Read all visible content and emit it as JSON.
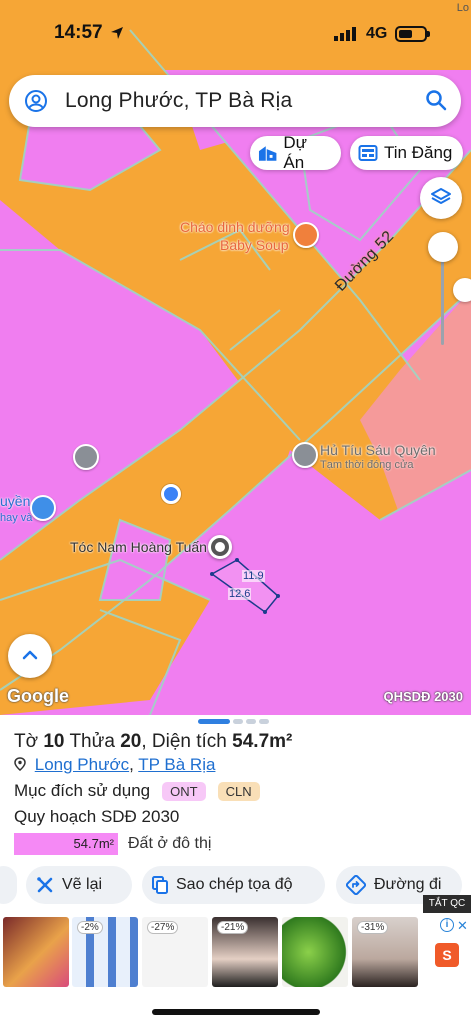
{
  "status_bar": {
    "time": "14:57",
    "network": "4G",
    "corner_text": "Lo"
  },
  "search": {
    "query": "Long Phước, TP Bà Rịa"
  },
  "chips": {
    "du_an": "Dự Án",
    "tin_dang": "Tin Đăng"
  },
  "map": {
    "road_label": "Đường 52",
    "poi_baby_soup_line1": "Cháo dinh dưỡng",
    "poi_baby_soup_line2": "Baby Soup",
    "poi_hu_tiu": "Hủ Tíu Sáu Quyên",
    "poi_hu_tiu_status": "Tạm thời đóng cửa",
    "poi_left_partial": "uyền",
    "poi_left_partial_sub": "hay và",
    "poi_toc": "Tóc Nam Hoàng Tuấn",
    "dim_a": "11.9",
    "dim_b": "12.6",
    "google_logo": "Google",
    "layer_label": "QHSDĐ 2030",
    "colors": {
      "residential": "#f07ef0",
      "road": "#f6a636",
      "boundary": "#9fd5c4",
      "commercial": "#f59a9a"
    }
  },
  "sheet": {
    "title_prefix": "Tờ",
    "to_number": "10",
    "thua_label": "Thửa",
    "thua_number": "20",
    "area_label": ", Diện tích",
    "area_value": "54.7m²",
    "addr_ward": "Long Phước",
    "addr_sep": ",",
    "addr_city": "TP Bà Rịa",
    "purpose_label": "Mục đích sử dụng",
    "tag_ont": "ONT",
    "tag_cln": "CLN",
    "plan_label": "Quy hoạch SDĐ 2030",
    "plan_area": "54.7m²",
    "plan_desc": "Đất ở đô thị",
    "actions": {
      "redraw": "Vẽ lại",
      "copy_coords": "Sao chép tọa độ",
      "directions": "Đường đi"
    },
    "ads": {
      "close_label": "TẮT QC",
      "discounts": [
        "-2%",
        "-27%",
        "-21%",
        "-31%"
      ],
      "shop_letter": "S"
    }
  }
}
